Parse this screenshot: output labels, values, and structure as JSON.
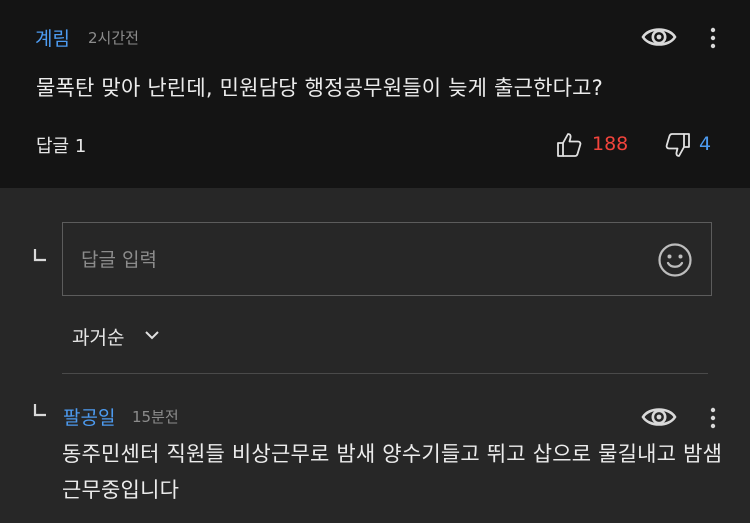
{
  "comment": {
    "author": "계림",
    "time": "2시간전",
    "text": "물폭탄 맞아 난린데, 민원담당 행정공무원들이 늦게 출근한다고?",
    "replies_label": "답글 1",
    "likes": "188",
    "dislikes": "4"
  },
  "reply_input": {
    "placeholder": "답글 입력"
  },
  "sort": {
    "label": "과거순"
  },
  "reply": {
    "author": "팔공일",
    "time": "15분전",
    "text": "동주민센터 직원들 비상근무로 밤새 양수기들고 뛰고 삽으로 물길내고 밤샘근무중입니다"
  },
  "colors": {
    "author": "#4d9bf0",
    "likes": "#f2443c",
    "dislikes": "#4d9bf0",
    "top_background": "#141414",
    "background": "#272727"
  },
  "icons": [
    "eye-icon",
    "more-icon",
    "thumbs-up-icon",
    "thumbs-down-icon",
    "reply-corner-icon",
    "smiley-icon",
    "chevron-down-icon"
  ]
}
